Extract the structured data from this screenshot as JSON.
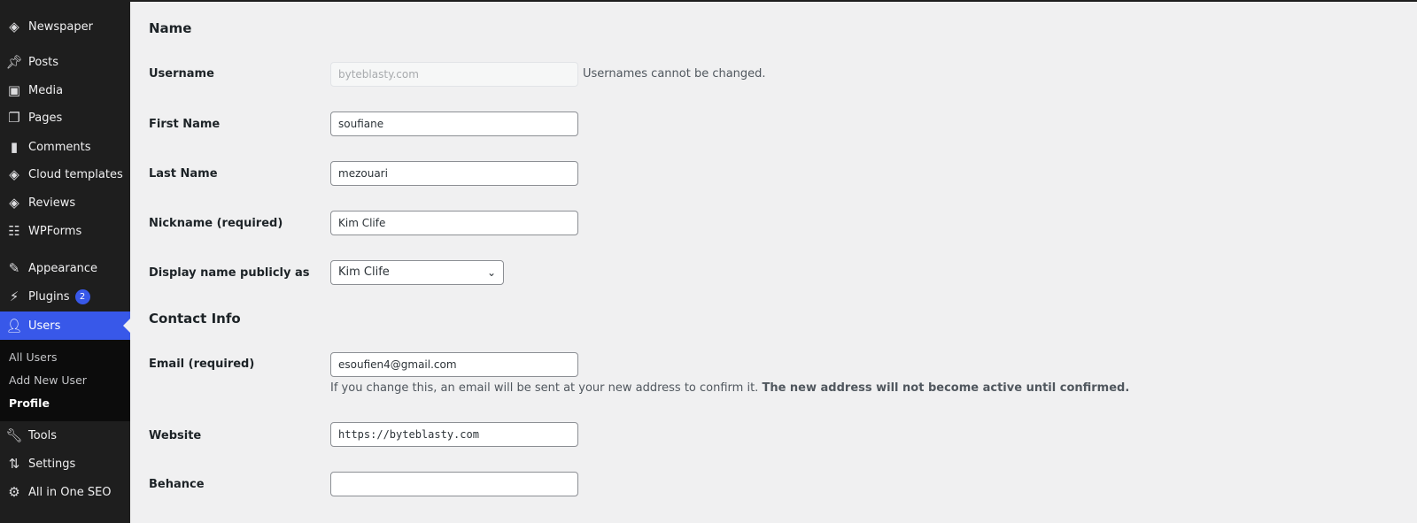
{
  "sidebar": {
    "items": [
      {
        "label": "Newspaper",
        "icon": "newspaper-logo-icon"
      },
      {
        "label": "Posts",
        "icon": "pin-icon"
      },
      {
        "label": "Media",
        "icon": "media-icon"
      },
      {
        "label": "Pages",
        "icon": "pages-icon"
      },
      {
        "label": "Comments",
        "icon": "comment-icon"
      },
      {
        "label": "Cloud templates",
        "icon": "newspaper-logo-icon"
      },
      {
        "label": "Reviews",
        "icon": "newspaper-logo-icon"
      },
      {
        "label": "WPForms",
        "icon": "form-icon"
      },
      {
        "label": "Appearance",
        "icon": "brush-icon"
      },
      {
        "label": "Plugins",
        "icon": "plugin-icon",
        "badge": "2"
      },
      {
        "label": "Users",
        "icon": "user-icon",
        "active": true
      },
      {
        "label": "Tools",
        "icon": "wrench-icon"
      },
      {
        "label": "Settings",
        "icon": "settings-icon"
      },
      {
        "label": "All in One SEO",
        "icon": "seo-icon"
      }
    ],
    "submenu": [
      "All Users",
      "Add New User",
      "Profile"
    ]
  },
  "form": {
    "name_heading": "Name",
    "username": {
      "label": "Username",
      "value": "byteblasty.com",
      "note": "Usernames cannot be changed."
    },
    "first_name": {
      "label": "First Name",
      "value": "soufiane"
    },
    "last_name": {
      "label": "Last Name",
      "value": "mezouari"
    },
    "nickname": {
      "label": "Nickname (required)",
      "value": "Kim Clife"
    },
    "display_name": {
      "label": "Display name publicly as",
      "value": "Kim Clife"
    },
    "contact_heading": "Contact Info",
    "email": {
      "label": "Email (required)",
      "value": "esoufien4@gmail.com",
      "note": "If you change this, an email will be sent at your new address to confirm it.",
      "note_bold": "The new address will not become active until confirmed."
    },
    "website": {
      "label": "Website",
      "value": "https://byteblasty.com"
    },
    "behance": {
      "label": "Behance",
      "value": ""
    }
  },
  "colors": {
    "accent": "#3858e9",
    "sidebar": "#1e1e1e",
    "background": "#f0f0f1"
  }
}
